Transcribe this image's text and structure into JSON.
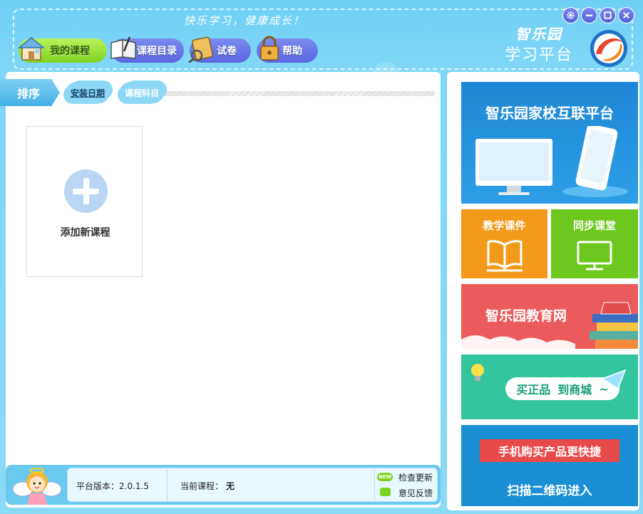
{
  "header": {
    "slogan": "快乐学习，健康成长！",
    "brand_top": "智乐园",
    "brand_bottom": "学习平台"
  },
  "nav": {
    "tabs": [
      {
        "label": "我的课程",
        "icon": "house-icon"
      },
      {
        "label": "课程目录",
        "icon": "book-icon"
      },
      {
        "label": "试卷",
        "icon": "paper-icon"
      },
      {
        "label": "帮助",
        "icon": "lock-icon"
      }
    ]
  },
  "window_controls": {
    "icons": [
      "gear-icon",
      "minimize-icon",
      "maximize-icon",
      "close-icon"
    ]
  },
  "sort": {
    "label": "排序",
    "options": [
      "安装日期",
      "课程科目"
    ]
  },
  "main": {
    "add_course_label": "添加新课程"
  },
  "status": {
    "version_label": "平台版本：2.0.1.5",
    "course_label": "当前课程：",
    "course_value": "无",
    "new_badge": "NEW",
    "check_update": "检查更新",
    "feedback": "意见反馈"
  },
  "ads": {
    "home_school": "智乐园家校互联平台",
    "courseware": "教学课件",
    "sync_class": "同步课堂",
    "edu_net": "智乐园教育网",
    "shop_a": "买正品",
    "shop_b": "到商城",
    "shop_tilde": "~",
    "mobile_buy": "手机购买产品更快捷",
    "scan_qr": "扫描二维码进入"
  },
  "colors": {
    "nav_active": "#7ed321",
    "nav_inactive": "#5a66df",
    "courseware_bg": "#f39a1a",
    "sync_bg": "#6cc81e",
    "edu_bg": "#ec5b5b",
    "shop_bg": "#33c69e",
    "mobile_bg": "#1b8fd3"
  }
}
